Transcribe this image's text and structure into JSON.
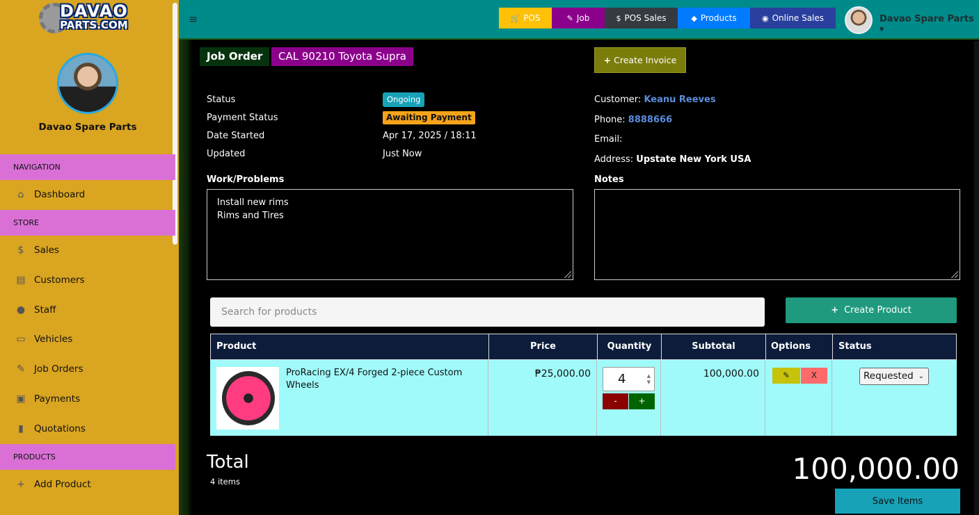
{
  "brand": {
    "logo_line1": "DAVAO",
    "logo_line2": "PARTS.COM",
    "name": "Davao Spare Parts"
  },
  "sidebar": {
    "sections": [
      {
        "label": "NAVIGATION"
      },
      {
        "label": "STORE"
      },
      {
        "label": "PRODUCTS"
      }
    ],
    "items": [
      {
        "label": "Dashboard",
        "icon": "home-icon"
      },
      {
        "label": "Sales",
        "icon": "dollar-icon"
      },
      {
        "label": "Customers",
        "icon": "address-card-icon"
      },
      {
        "label": "Staff",
        "icon": "user-icon"
      },
      {
        "label": "Vehicles",
        "icon": "car-icon"
      },
      {
        "label": "Job Orders",
        "icon": "wrench-icon"
      },
      {
        "label": "Payments",
        "icon": "money-icon"
      },
      {
        "label": "Quotations",
        "icon": "file-icon"
      },
      {
        "label": "Add Product",
        "icon": "plus-icon"
      }
    ]
  },
  "topbar": {
    "nav": [
      {
        "label": "POS",
        "icon": "cart-icon",
        "color": "#ffc107"
      },
      {
        "label": "Job",
        "icon": "wrench-icon",
        "color": "#8b008b"
      },
      {
        "label": "POS Sales",
        "icon": "dollar-icon",
        "color": "#343a40"
      },
      {
        "label": "Products",
        "icon": "tag-icon",
        "color": "#007bff"
      },
      {
        "label": "Online Sales",
        "icon": "globe-icon",
        "color": "#2a3f9d"
      }
    ],
    "user": "Davao Spare Parts"
  },
  "job": {
    "tag": "Job Order",
    "vehicle": "CAL 90210 Toyota Supra",
    "create_invoice": "Create Invoice",
    "fields": [
      {
        "label": "Status",
        "value": "Ongoing"
      },
      {
        "label": "Payment Status",
        "value": "Awaiting Payment"
      },
      {
        "label": "Date Started",
        "value": "Apr 17, 2025 / 18:11"
      },
      {
        "label": "Updated",
        "value": "Just Now"
      }
    ],
    "customer": {
      "customer_label": "Customer:",
      "customer_value": "Keanu Reeves",
      "phone_label": "Phone:",
      "phone_value": "8888666",
      "email_label": "Email:",
      "email_value": "",
      "address_label": "Address:",
      "address_value": "Upstate New York USA"
    },
    "work_title": "Work/Problems",
    "work_lines": [
      "Install new rims",
      "Rims and Tires"
    ],
    "notes_title": "Notes",
    "notes_text": ""
  },
  "products": {
    "search_placeholder": "Search for products",
    "create_label": "Create Product",
    "columns": [
      "Product",
      "Price",
      "Quantity",
      "Subtotal",
      "Options",
      "Status"
    ],
    "rows": [
      {
        "name": "ProRacing EX/4 Forged 2-piece Custom Wheels",
        "price": "₱25,000.00",
        "qty": "4",
        "minus": "-",
        "plus": "+",
        "subtotal": "100,000.00",
        "delete": "X",
        "status": "Requested"
      }
    ]
  },
  "totals": {
    "label": "Total",
    "items": "4 items",
    "value": "100,000.00",
    "save": "Save Items"
  }
}
